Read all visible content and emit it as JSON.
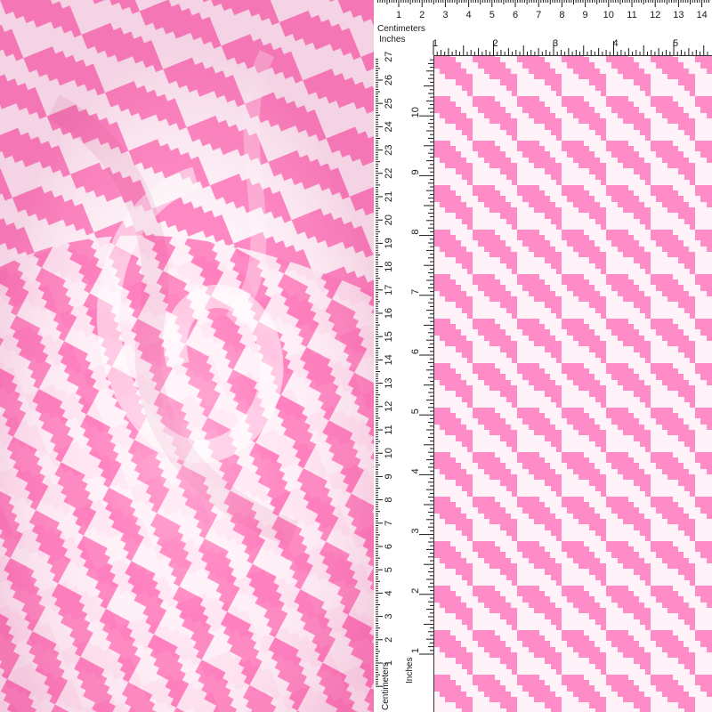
{
  "image": {
    "subject": "pink-and-white-houndstooth-fabric",
    "colors": {
      "pink": "#ff8cc6",
      "pink_deep": "#ff6fb5",
      "white": "#fff6fb",
      "ruler_bg": "#ffffff",
      "ruler_ink": "#1a1a1a"
    }
  },
  "rulers": {
    "top": {
      "centimeters_label": "Centimeters",
      "inches_label": "Inches",
      "cm_numbers": [
        "1",
        "2",
        "3",
        "4",
        "5",
        "6",
        "7",
        "8",
        "9",
        "10",
        "11",
        "12",
        "13",
        "14"
      ],
      "in_numbers": [
        "1",
        "2",
        "3",
        "4",
        "5"
      ]
    },
    "left": {
      "centimeters_label": "Centimeters",
      "inches_label": "Inches",
      "cm_numbers": [
        "1",
        "2",
        "3",
        "4",
        "5",
        "6",
        "7",
        "8",
        "9",
        "10",
        "11",
        "12",
        "13",
        "14",
        "15",
        "16",
        "17",
        "18",
        "19",
        "20",
        "21",
        "22",
        "23",
        "24",
        "25",
        "26",
        "27"
      ],
      "in_numbers": [
        "1",
        "2",
        "3",
        "4",
        "5",
        "6",
        "7",
        "8",
        "9",
        "10"
      ]
    }
  }
}
